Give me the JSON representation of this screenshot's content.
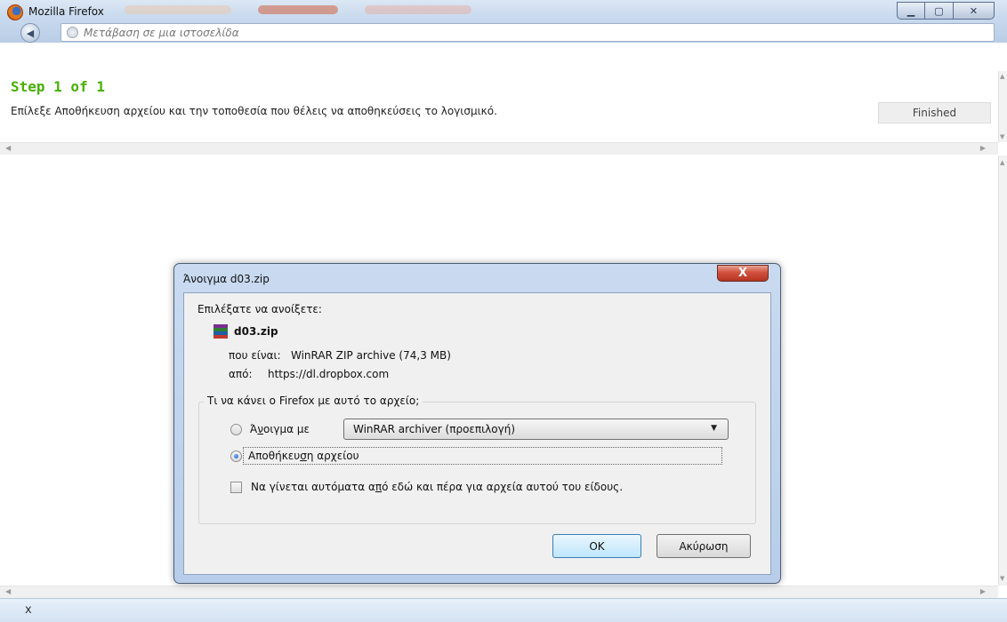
{
  "window": {
    "title": "Mozilla Firefox",
    "minimize_glyph": "▁",
    "maximize_glyph": "▢",
    "close_glyph": "✕"
  },
  "location_bar": {
    "placeholder": "Μετάβαση σε μια ιστοσελίδα"
  },
  "notification": {
    "step_title": "Step 1 of 1",
    "description": "Επίλεξε Αποθήκευση αρχείου και την τοποθεσία που θέλεις να αποθηκεύσεις το λογισμικό.",
    "finished_label": "Finished"
  },
  "bottom_bar": {
    "close_label": "x"
  },
  "dialog": {
    "title": "Άνοιγμα d03.zip",
    "close_glyph": "X",
    "chosen_label": "Επιλέξατε να ανοίξετε:",
    "file_name": "d03.zip",
    "type_label": "που είναι:",
    "type_value": "WinRAR ZIP archive (74,3 MB)",
    "from_label": "από:",
    "from_value": "https://dl.dropbox.com",
    "group_title": "Τι να κάνει ο Firefox  με αυτό το αρχείο;",
    "open_with": {
      "before": "Ά",
      "accel": "ν",
      "after": "οιγμα με",
      "checked": false
    },
    "app_select_value": "WinRAR archiver (προεπιλογή)",
    "save_file": {
      "before": "Αποθήκευ",
      "accel": "σ",
      "after": "η αρχείου",
      "checked": true
    },
    "auto_option": {
      "before": "Να γίνεται αυτόματα α",
      "accel": "π",
      "after": "ό εδώ και πέρα για αρχεία αυτού του είδους.",
      "checked": false
    },
    "ok_label": "OK",
    "cancel_label": "Ακύρωση"
  },
  "colors": {
    "step_title": "#45b000",
    "dialog_frame": "#b7cde9",
    "close_button": "#c74431",
    "ok_button": "#bee6fd"
  }
}
